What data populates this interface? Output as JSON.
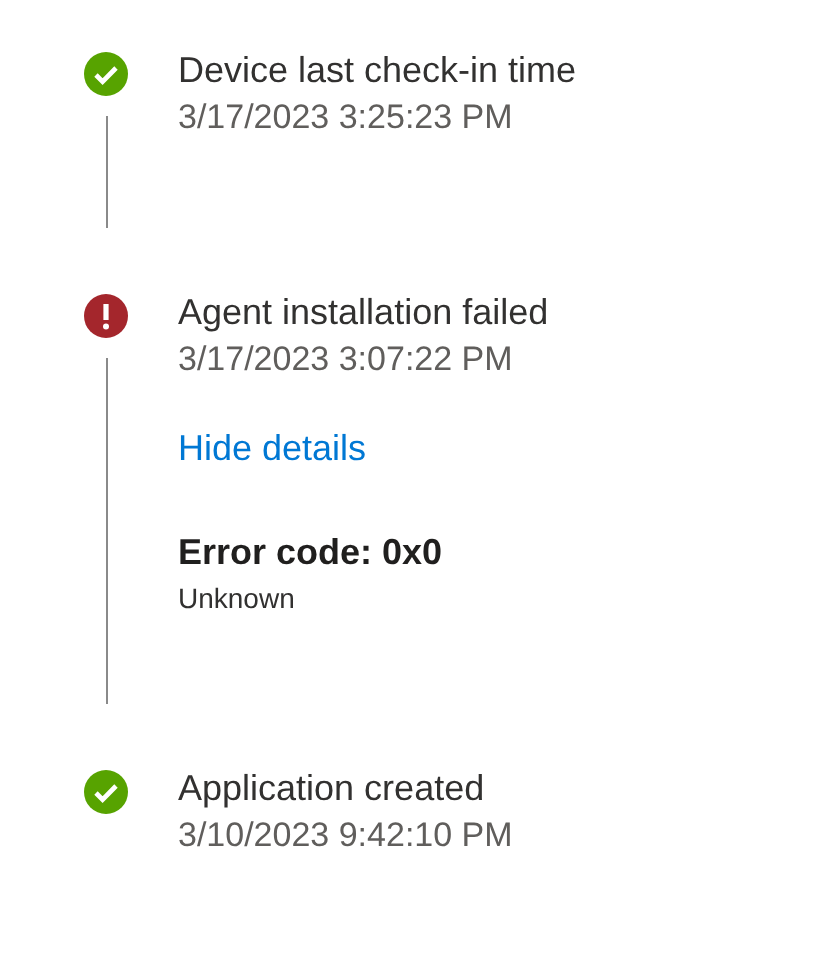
{
  "events": [
    {
      "kind": "success",
      "title": "Device last check-in time",
      "time": "3/17/2023 3:25:23 PM"
    },
    {
      "kind": "error",
      "title": "Agent installation failed",
      "time": "3/17/2023 3:07:22 PM",
      "details": {
        "link": "Hide details",
        "error_title": "Error code: 0x0",
        "error_message": "Unknown"
      }
    },
    {
      "kind": "success",
      "title": "Application created",
      "time": "3/10/2023 9:42:10 PM"
    }
  ]
}
